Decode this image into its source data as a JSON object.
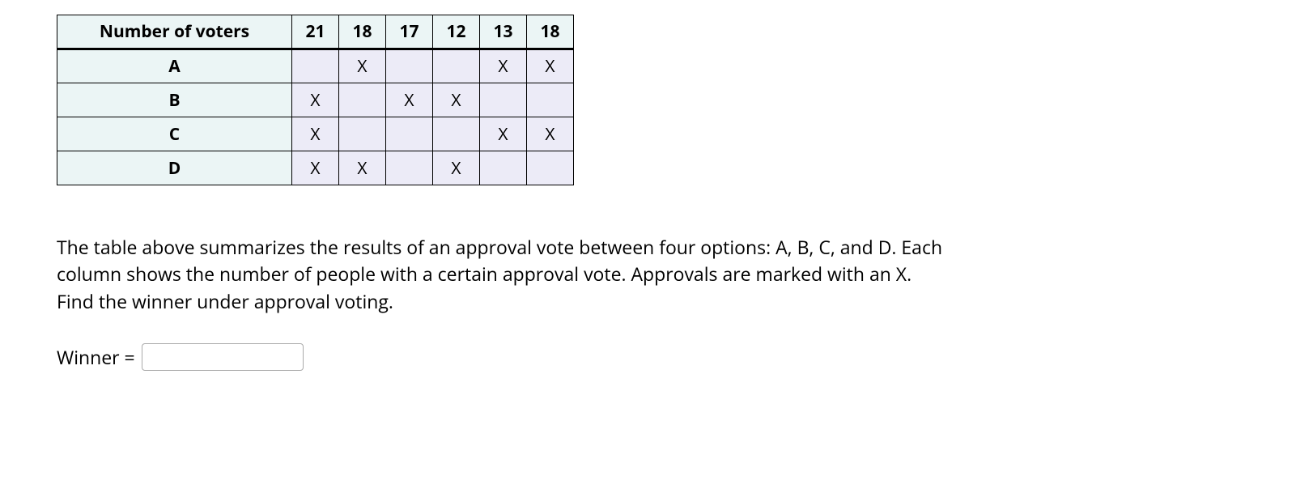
{
  "table": {
    "header_label": "Number of voters",
    "columns": [
      "21",
      "18",
      "17",
      "12",
      "13",
      "18"
    ],
    "rows": [
      {
        "label": "A",
        "marks": [
          "",
          "X",
          "",
          "",
          "X",
          "X"
        ]
      },
      {
        "label": "B",
        "marks": [
          "X",
          "",
          "X",
          "X",
          "",
          ""
        ]
      },
      {
        "label": "C",
        "marks": [
          "X",
          "",
          "",
          "",
          "X",
          "X"
        ]
      },
      {
        "label": "D",
        "marks": [
          "X",
          "X",
          "",
          "X",
          "",
          ""
        ]
      }
    ]
  },
  "question": "The table above summarizes the results of an approval vote between four options: A, B, C, and D. Each column shows the number of people with a certain approval vote. Approvals are marked with an X. Find the winner under approval voting.",
  "answer": {
    "label": "Winner =",
    "value": ""
  }
}
